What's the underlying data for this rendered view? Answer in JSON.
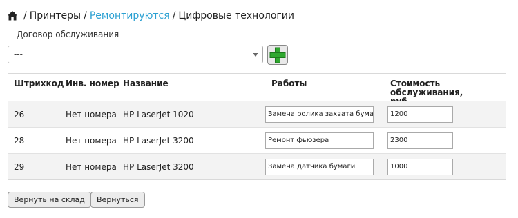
{
  "breadcrumb": {
    "home_icon": "home-icon",
    "sep": "/",
    "items": [
      "Принтеры",
      "Ремонтируются",
      "Цифровые технологии"
    ]
  },
  "contract": {
    "label": "Договор обслуживания",
    "selected": "---"
  },
  "add_button_icon": "plus-icon",
  "table": {
    "headers": {
      "barcode": "Штрихкод",
      "inv": "Инв. номер",
      "name": "Название",
      "works": "Работы",
      "cost_line1": "Стоимость обслуживания,",
      "cost_line2": "руб."
    },
    "rows": [
      {
        "barcode": "26",
        "inv": "Нет номера",
        "name": "HP LaserJet 1020",
        "work": "Замена ролика захвата бумаги",
        "cost": "1200"
      },
      {
        "barcode": "28",
        "inv": "Нет номера",
        "name": "HP LaserJet 3200",
        "work": "Ремонт фьюзера",
        "cost": "2300"
      },
      {
        "barcode": "29",
        "inv": "Нет номера",
        "name": "HP LaserJet 3200",
        "work": "Замена датчика бумаги",
        "cost": "1000"
      }
    ]
  },
  "buttons": {
    "return_to_stock": "Вернуть на склад",
    "back": "Вернуться"
  },
  "colors": {
    "link": "#2aa0d2",
    "plus_green": "#2fa82f"
  }
}
